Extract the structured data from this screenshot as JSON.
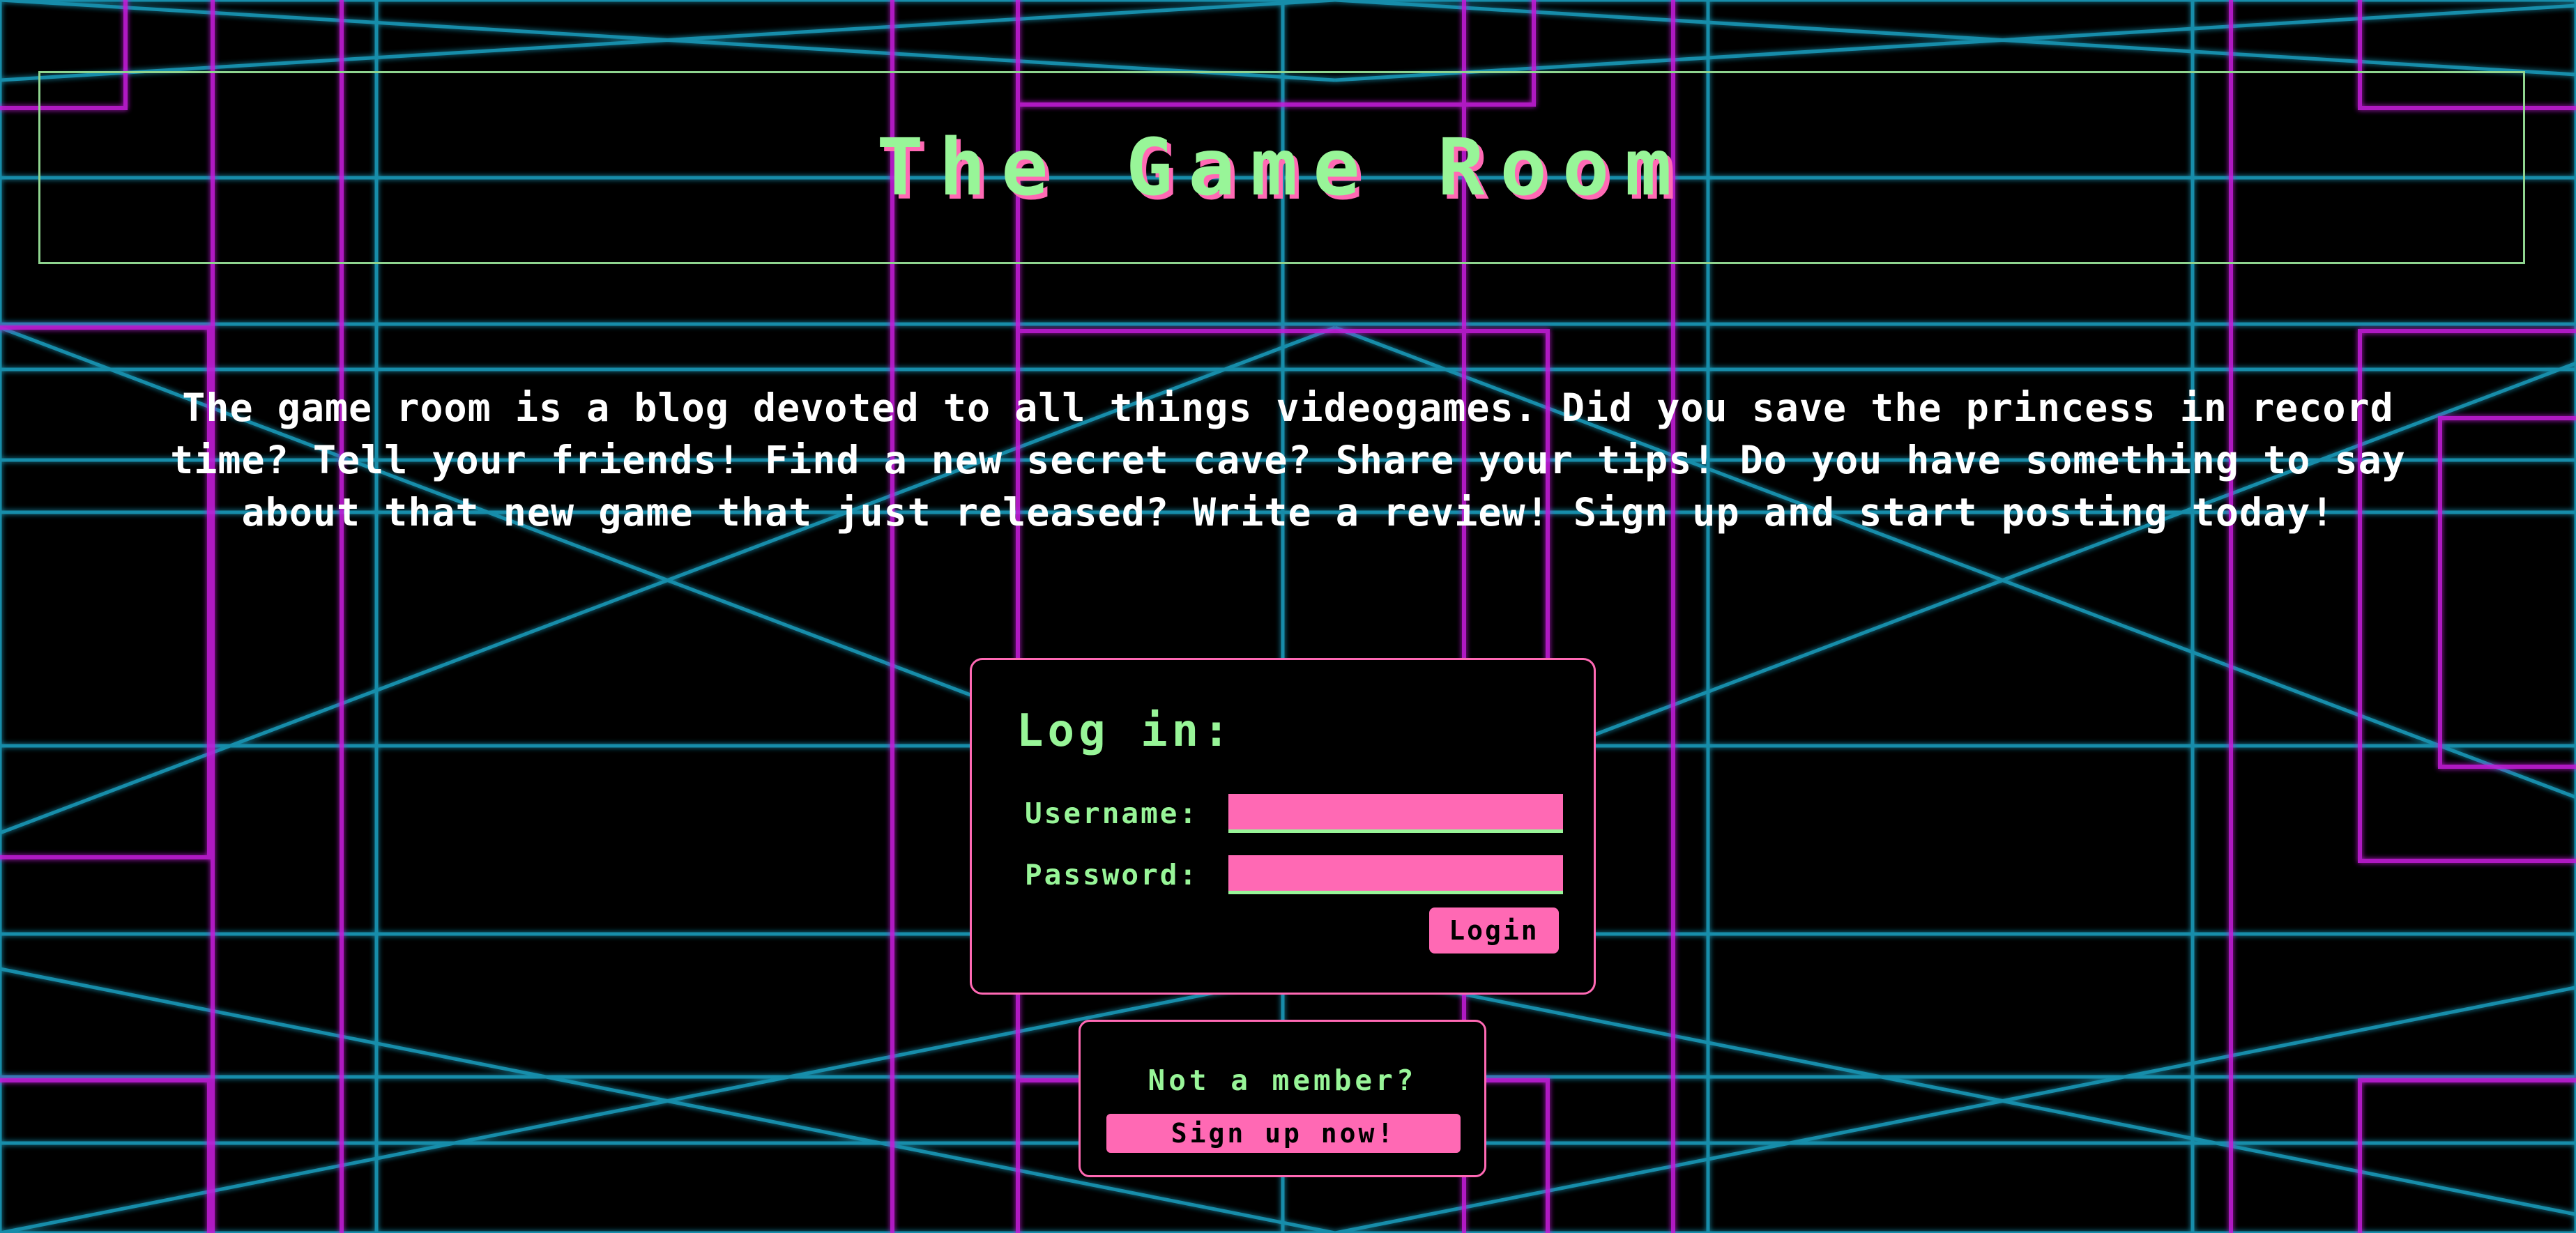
{
  "header": {
    "title": "The Game Room"
  },
  "intro": {
    "text": "The game room is a blog devoted to all things videogames. Did you save the princess in record time? Tell your friends! Find a new secret cave? Share your tips! Do you have something to say about that new game that just released? Write a review! Sign up and start posting today!"
  },
  "login": {
    "heading": "Log in:",
    "username_label": "Username:",
    "username_value": "",
    "password_label": "Password:",
    "password_value": "",
    "button_label": "Login"
  },
  "signup": {
    "prompt": "Not a member?",
    "button_label": "Sign up now!"
  },
  "colors": {
    "background": "#000000",
    "accent_green": "#98f598",
    "accent_pink": "#ff69b4",
    "grid_cyan": "#1aa6c8",
    "grid_magenta": "#c21fd8"
  }
}
